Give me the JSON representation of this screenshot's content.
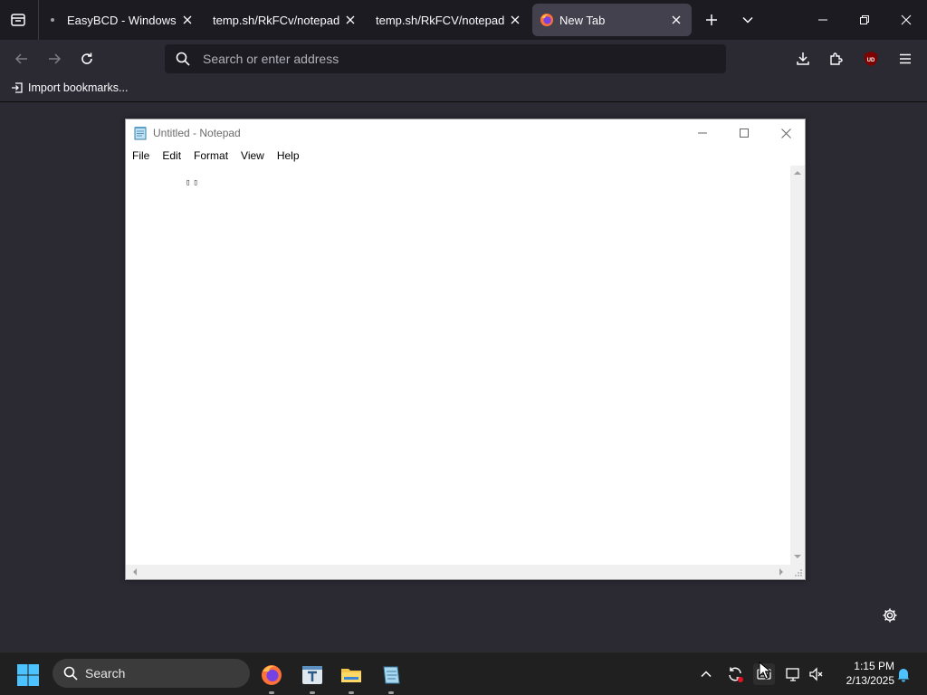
{
  "browser": {
    "tabs": [
      {
        "title": "EasyBCD - Windows Bo",
        "active": false
      },
      {
        "title": "temp.sh/RkFCv/notepad.ex",
        "active": false
      },
      {
        "title": "temp.sh/RkFCV/notepad.ex",
        "active": false
      },
      {
        "title": "New Tab",
        "active": true
      }
    ],
    "urlbar": {
      "placeholder": "Search or enter address",
      "value": ""
    },
    "bookmarks": [
      {
        "label": "Import bookmarks..."
      }
    ],
    "accent_color": "#42414d",
    "extension_badge": "UD"
  },
  "notepad": {
    "title": "Untitled - Notepad",
    "menu": [
      "File",
      "Edit",
      "Format",
      "View",
      "Help"
    ],
    "content": "▯▯"
  },
  "taskbar": {
    "search_label": "Search",
    "apps": [
      "firefox-icon",
      "text-editor-icon",
      "file-explorer-icon",
      "notepad-icon"
    ],
    "clock": {
      "time": "1:15 PM",
      "date": "2/13/2025"
    }
  }
}
